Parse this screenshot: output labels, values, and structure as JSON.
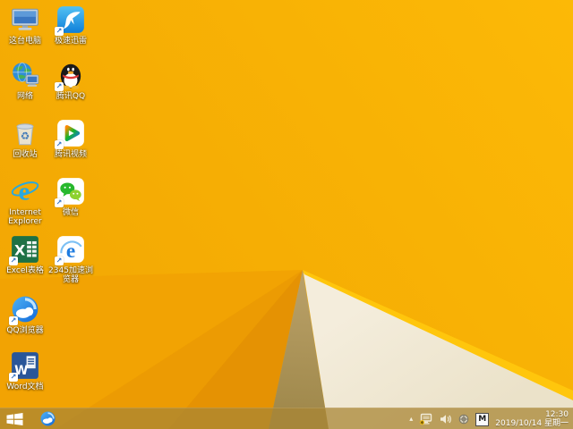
{
  "desktop": {
    "icons": [
      {
        "label": "这台电脑",
        "shortcut": false
      },
      {
        "label": "极速迅雷",
        "shortcut": true
      },
      {
        "label": "网络",
        "shortcut": false
      },
      {
        "label": "腾讯QQ",
        "shortcut": true
      },
      {
        "label": "回收站",
        "shortcut": false
      },
      {
        "label": "腾讯视频",
        "shortcut": true
      },
      {
        "label": "Internet Explorer",
        "shortcut": false
      },
      {
        "label": "微信",
        "shortcut": true
      },
      {
        "label": "Excel表格",
        "shortcut": true
      },
      {
        "label": "2345加速浏览器",
        "shortcut": true
      },
      {
        "label": "QQ浏览器",
        "shortcut": true
      },
      {
        "label": "Word文档",
        "shortcut": true
      }
    ]
  },
  "taskbar": {
    "tray": {
      "chevron": "▴",
      "ime_badge": "M",
      "time": "12:30",
      "date": "2019/10/14 星期一"
    }
  },
  "colors": {
    "wallpaper_main_light": "#FCB906",
    "wallpaper_main": "#F4A902",
    "wallpaper_shade1": "#F2A303",
    "wallpaper_shade2": "#EC9B03",
    "wallpaper_shade3": "#E59203",
    "wallpaper_tan_light": "#BBA26A",
    "wallpaper_tan_dark": "#9D8648",
    "wallpaper_cream": "#F3ECDA",
    "wallpaper_ridge": "#FFC60C",
    "taskbar_tint": "rgba(168,133,53,0.74)"
  }
}
